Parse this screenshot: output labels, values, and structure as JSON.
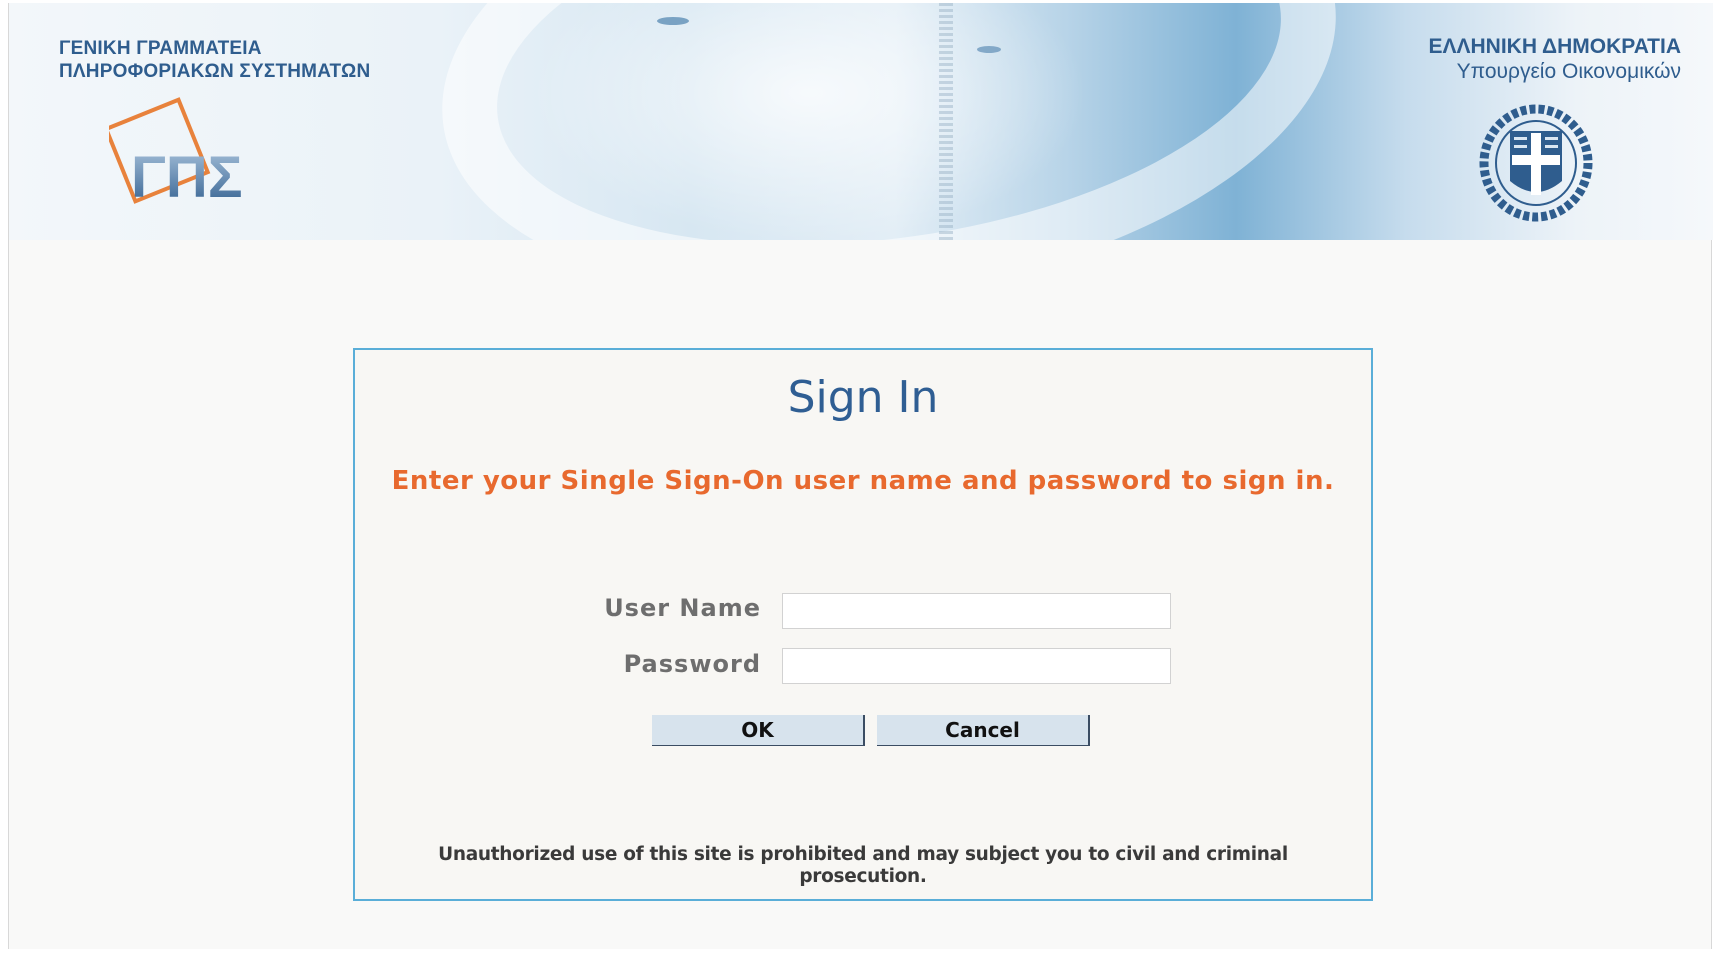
{
  "header": {
    "org_left_line1": "ΓΕΝΙΚΗ ΓΡΑΜΜΑΤΕΙΑ",
    "org_left_line2": "ΠΛΗΡΟΦΟΡΙΑΚΩΝ ΣΥΣΤΗΜΑΤΩΝ",
    "org_right_line1": "ΕΛΛΗΝΙΚΗ ΔΗΜΟΚΡΑΤΙΑ",
    "org_right_line2": "Υπουργείο Οικονομικών",
    "logo_left": "gps-logo-icon",
    "logo_right": "greek-coat-of-arms-icon",
    "logo_left_text": "ΓΠΣ"
  },
  "signin": {
    "title": "Sign In",
    "instruction": "Enter your Single Sign-On user name and password to sign in.",
    "username_label": "User Name",
    "username_value": "",
    "password_label": "Password",
    "password_value": "",
    "ok_label": "OK",
    "cancel_label": "Cancel",
    "notice": "Unauthorized use of this site is prohibited and may subject you to civil and criminal prosecution."
  },
  "colors": {
    "title": "#2f5e93",
    "instruction": "#e8692e",
    "box_border": "#5aaed8",
    "header_text": "#2f5d8e"
  }
}
